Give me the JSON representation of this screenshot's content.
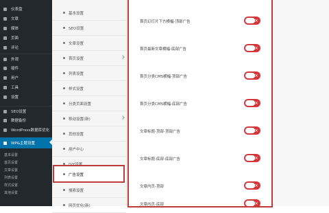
{
  "wp_menu": {
    "items": [
      {
        "label": "仪表盘"
      },
      {
        "label": "文章"
      },
      {
        "label": "媒体"
      },
      {
        "label": "页面"
      },
      {
        "label": "评论"
      },
      {
        "label": "外观"
      },
      {
        "label": "插件"
      },
      {
        "label": "用户"
      },
      {
        "label": "工具"
      },
      {
        "label": "设置"
      },
      {
        "label": "SEO设置"
      },
      {
        "label": "数据备份"
      },
      {
        "label": "WordPress数据库优化"
      },
      {
        "label": "WP&主题设置"
      }
    ],
    "submenu": [
      {
        "label": "基本设置"
      },
      {
        "label": "首页设置"
      },
      {
        "label": "文章设置"
      },
      {
        "label": "列表设置"
      },
      {
        "label": "样式设置"
      },
      {
        "label": "其他设置"
      }
    ]
  },
  "settings_menu": {
    "items": [
      {
        "label": "基本设置"
      },
      {
        "label": "SEO设置"
      },
      {
        "label": "文章设置"
      },
      {
        "label": "首页设置"
      },
      {
        "label": "列表设置"
      },
      {
        "label": "样式设置"
      },
      {
        "label": "分类页面设置"
      },
      {
        "label": "移动设置(新)"
      },
      {
        "label": "其他设置"
      },
      {
        "label": "用户中心"
      },
      {
        "label": "DIY设置"
      },
      {
        "label": "广告设置"
      },
      {
        "label": "搜索设置"
      },
      {
        "label": "网页优化(新)"
      }
    ],
    "selected_index": 11
  },
  "ad_settings": [
    {
      "label": "首页幻灯片下方横幅-顶部广告",
      "toggle": "off",
      "mark": "×"
    },
    {
      "label": "首页最新文章横幅-底部广告",
      "toggle": "off",
      "mark": "×"
    },
    {
      "label": "首页分类CMS横幅-顶部广告",
      "toggle": "off",
      "mark": "×"
    },
    {
      "label": "首页分类CMS横幅-底部广告",
      "toggle": "off",
      "mark": "×"
    },
    {
      "label": "文章标题-顶部-顶部广告",
      "toggle": "off",
      "mark": "×"
    },
    {
      "label": "文章标题-底部-底部广告",
      "toggle": "off",
      "mark": "×"
    },
    {
      "label": "文章内页-顶部",
      "toggle": "off",
      "mark": "×"
    },
    {
      "label": "文章内页-底部",
      "toggle": "off",
      "mark": "×"
    }
  ],
  "colors": {
    "highlight_border": "#c0393b",
    "toggle_off": "#d0393b",
    "wp_admin_bg": "#23282d",
    "wp_active": "#0073aa"
  }
}
